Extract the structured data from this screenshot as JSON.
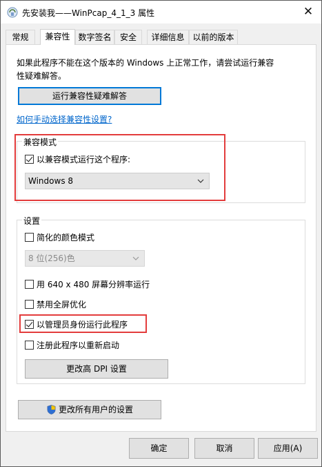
{
  "window": {
    "title": "先安装我——WinPcap_4_1_3 属性",
    "close_symbol": "✕"
  },
  "tabs": [
    {
      "label": "常规"
    },
    {
      "label": "兼容性"
    },
    {
      "label": "数字签名"
    },
    {
      "label": "安全"
    },
    {
      "label": "详细信息"
    },
    {
      "label": "以前的版本"
    }
  ],
  "compat": {
    "info_text": "如果此程序不能在这个版本的 Windows 上正常工作，请尝试运行兼容性疑难解答。",
    "troubleshoot_button": "运行兼容性疑难解答",
    "manual_link": "如何手动选择兼容性设置?",
    "mode_group": {
      "legend": "兼容模式",
      "checkbox_label": "以兼容模式运行这个程序:",
      "checked": true,
      "os_selected": "Windows 8"
    },
    "settings_group": {
      "legend": "设置",
      "reduced_color": {
        "label": "简化的颜色模式",
        "checked": false
      },
      "color_select": "8 位(256)色",
      "res_640": {
        "label": "用 640 x 480 屏幕分辨率运行",
        "checked": false
      },
      "disable_fullscreen": {
        "label": "禁用全屏优化",
        "checked": false
      },
      "run_as_admin": {
        "label": "以管理员身份运行此程序",
        "checked": true
      },
      "register_restart": {
        "label": "注册此程序以重新启动",
        "checked": false
      },
      "dpi_button": "更改高 DPI 设置"
    },
    "all_users_button": "更改所有用户的设置"
  },
  "buttons": {
    "ok": "确定",
    "cancel": "取消",
    "apply": "应用(A)"
  },
  "colors": {
    "highlight_red": "#e33b3b",
    "focus_blue": "#0078d7",
    "link_blue": "#0066cc"
  }
}
